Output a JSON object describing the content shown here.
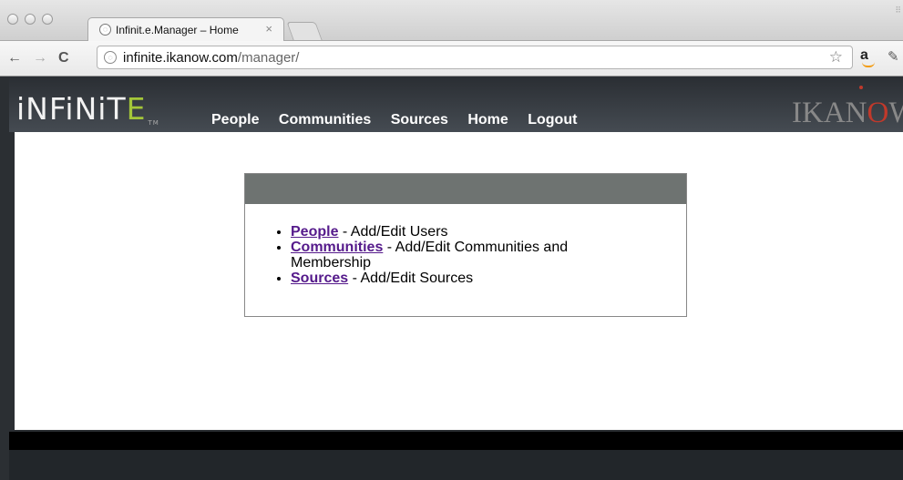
{
  "browser": {
    "tab_title": "Infinit.e.Manager – Home",
    "tab_close": "×",
    "url_host": "infinite.ikanow.com",
    "url_path": "/manager/",
    "back": "←",
    "forward": "→",
    "reload": "C",
    "star": "☆",
    "amazon": "a",
    "wrench": "🔧"
  },
  "site": {
    "logo_pre": "iNFiNiT",
    "logo_e": "E",
    "logo_tm": "TM",
    "brand_pre": "IKAN",
    "brand_o": "O",
    "brand_post": "W",
    "nav": [
      "People",
      "Communities",
      "Sources",
      "Home",
      "Logout"
    ]
  },
  "panel": {
    "items": [
      {
        "link": "People",
        "desc": " - Add/Edit Users"
      },
      {
        "link": "Communities",
        "desc": " - Add/Edit Communities and Membership"
      },
      {
        "link": "Sources",
        "desc": " - Add/Edit Sources"
      }
    ]
  },
  "colors": {
    "nav_bg": "#3b4045",
    "panel_header": "#6e7371",
    "link": "#551a8b",
    "logo_accent": "#a4c639",
    "brand_accent": "#c0392b"
  }
}
